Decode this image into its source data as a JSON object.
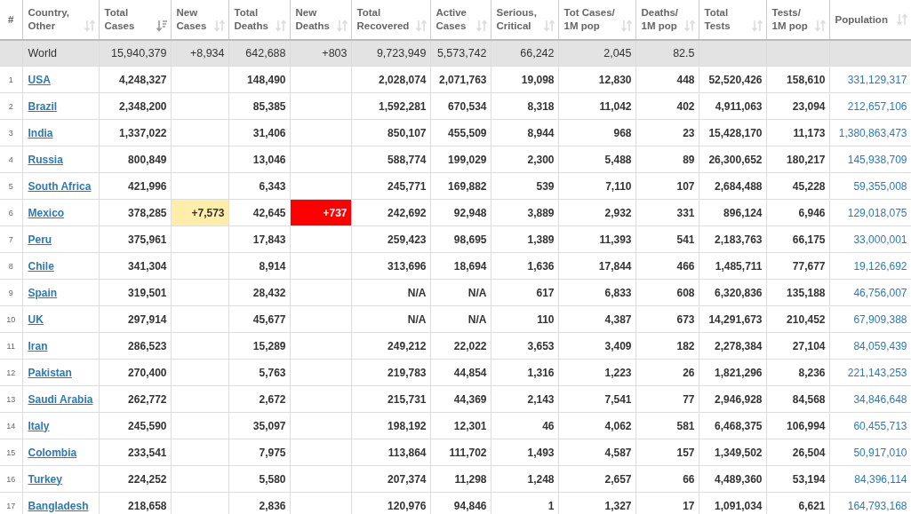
{
  "columns": [
    {
      "lines": [
        "#"
      ],
      "kind": "index"
    },
    {
      "lines": [
        "Country,",
        "Other"
      ],
      "kind": "sortable",
      "sorted": false
    },
    {
      "lines": [
        "Total",
        "Cases"
      ],
      "kind": "sortable",
      "sorted": true
    },
    {
      "lines": [
        "New",
        "Cases"
      ],
      "kind": "sortable",
      "sorted": false
    },
    {
      "lines": [
        "Total",
        "Deaths"
      ],
      "kind": "sortable",
      "sorted": false
    },
    {
      "lines": [
        "New",
        "Deaths"
      ],
      "kind": "sortable",
      "sorted": false
    },
    {
      "lines": [
        "Total",
        "Recovered"
      ],
      "kind": "sortable",
      "sorted": false
    },
    {
      "lines": [
        "Active",
        "Cases"
      ],
      "kind": "sortable",
      "sorted": false
    },
    {
      "lines": [
        "Serious,",
        "Critical"
      ],
      "kind": "sortable",
      "sorted": false
    },
    {
      "lines": [
        "Tot Cases/",
        "1M pop"
      ],
      "kind": "sortable",
      "sorted": false
    },
    {
      "lines": [
        "Deaths/",
        "1M pop"
      ],
      "kind": "sortable",
      "sorted": false
    },
    {
      "lines": [
        "Total",
        "Tests"
      ],
      "kind": "sortable",
      "sorted": false
    },
    {
      "lines": [
        "Tests/",
        "1M pop"
      ],
      "kind": "sortable",
      "sorted": false
    },
    {
      "lines": [
        "Population"
      ],
      "kind": "sortable",
      "sorted": false
    }
  ],
  "rows": [
    {
      "kind": "total",
      "country": "World",
      "total_cases": "15,940,379",
      "new_cases": "+8,934",
      "total_deaths": "642,688",
      "new_deaths": "+803",
      "total_recovered": "9,723,949",
      "active_cases": "5,573,742",
      "serious_critical": "66,242",
      "cases_per_1m": "2,045",
      "deaths_per_1m": "82.5"
    },
    {
      "kind": "country",
      "rank": "1",
      "country": "USA",
      "total_cases": "4,248,327",
      "total_deaths": "148,490",
      "total_recovered": "2,028,074",
      "active_cases": "2,071,763",
      "serious_critical": "19,098",
      "cases_per_1m": "12,830",
      "deaths_per_1m": "448",
      "total_tests": "52,520,426",
      "tests_per_1m": "158,610",
      "population": "331,129,317"
    },
    {
      "kind": "country",
      "rank": "2",
      "country": "Brazil",
      "total_cases": "2,348,200",
      "total_deaths": "85,385",
      "total_recovered": "1,592,281",
      "active_cases": "670,534",
      "serious_critical": "8,318",
      "cases_per_1m": "11,042",
      "deaths_per_1m": "402",
      "total_tests": "4,911,063",
      "tests_per_1m": "23,094",
      "population": "212,657,106"
    },
    {
      "kind": "country",
      "rank": "3",
      "country": "India",
      "total_cases": "1,337,022",
      "total_deaths": "31,406",
      "total_recovered": "850,107",
      "active_cases": "455,509",
      "serious_critical": "8,944",
      "cases_per_1m": "968",
      "deaths_per_1m": "23",
      "total_tests": "15,428,170",
      "tests_per_1m": "11,173",
      "population": "1,380,863,473"
    },
    {
      "kind": "country",
      "rank": "4",
      "country": "Russia",
      "total_cases": "800,849",
      "total_deaths": "13,046",
      "total_recovered": "588,774",
      "active_cases": "199,029",
      "serious_critical": "2,300",
      "cases_per_1m": "5,488",
      "deaths_per_1m": "89",
      "total_tests": "26,300,652",
      "tests_per_1m": "180,217",
      "population": "145,938,709"
    },
    {
      "kind": "country",
      "rank": "5",
      "country": "South Africa",
      "total_cases": "421,996",
      "total_deaths": "6,343",
      "total_recovered": "245,771",
      "active_cases": "169,882",
      "serious_critical": "539",
      "cases_per_1m": "7,110",
      "deaths_per_1m": "107",
      "total_tests": "2,684,488",
      "tests_per_1m": "45,228",
      "population": "59,355,008"
    },
    {
      "kind": "country",
      "rank": "6",
      "country": "Mexico",
      "total_cases": "378,285",
      "new_cases": "+7,573",
      "new_cases_highlight": {
        "color": "#ffeeaa"
      },
      "total_deaths": "42,645",
      "new_deaths": "+737",
      "new_deaths_highlight": {
        "color": "#ff0000"
      },
      "total_recovered": "242,692",
      "active_cases": "92,948",
      "serious_critical": "3,889",
      "cases_per_1m": "2,932",
      "deaths_per_1m": "331",
      "total_tests": "896,124",
      "tests_per_1m": "6,946",
      "population": "129,018,075"
    },
    {
      "kind": "country",
      "rank": "7",
      "country": "Peru",
      "total_cases": "375,961",
      "total_deaths": "17,843",
      "total_recovered": "259,423",
      "active_cases": "98,695",
      "serious_critical": "1,389",
      "cases_per_1m": "11,393",
      "deaths_per_1m": "541",
      "total_tests": "2,183,763",
      "tests_per_1m": "66,175",
      "population": "33,000,001"
    },
    {
      "kind": "country",
      "rank": "8",
      "country": "Chile",
      "total_cases": "341,304",
      "total_deaths": "8,914",
      "total_recovered": "313,696",
      "active_cases": "18,694",
      "serious_critical": "1,636",
      "cases_per_1m": "17,844",
      "deaths_per_1m": "466",
      "total_tests": "1,485,711",
      "tests_per_1m": "77,677",
      "population": "19,126,692"
    },
    {
      "kind": "country",
      "rank": "9",
      "country": "Spain",
      "total_cases": "319,501",
      "total_deaths": "28,432",
      "total_recovered": "N/A",
      "active_cases": "N/A",
      "serious_critical": "617",
      "cases_per_1m": "6,833",
      "deaths_per_1m": "608",
      "total_tests": "6,320,836",
      "tests_per_1m": "135,188",
      "population": "46,756,007"
    },
    {
      "kind": "country",
      "rank": "10",
      "country": "UK",
      "total_cases": "297,914",
      "total_deaths": "45,677",
      "total_recovered": "N/A",
      "active_cases": "N/A",
      "serious_critical": "110",
      "cases_per_1m": "4,387",
      "deaths_per_1m": "673",
      "total_tests": "14,291,673",
      "tests_per_1m": "210,452",
      "population": "67,909,388"
    },
    {
      "kind": "country",
      "rank": "11",
      "country": "Iran",
      "total_cases": "286,523",
      "total_deaths": "15,289",
      "total_recovered": "249,212",
      "active_cases": "22,022",
      "serious_critical": "3,653",
      "cases_per_1m": "3,409",
      "deaths_per_1m": "182",
      "total_tests": "2,278,384",
      "tests_per_1m": "27,104",
      "population": "84,059,439"
    },
    {
      "kind": "country",
      "rank": "12",
      "country": "Pakistan",
      "total_cases": "270,400",
      "total_deaths": "5,763",
      "total_recovered": "219,783",
      "active_cases": "44,854",
      "serious_critical": "1,316",
      "cases_per_1m": "1,223",
      "deaths_per_1m": "26",
      "total_tests": "1,821,296",
      "tests_per_1m": "8,236",
      "population": "221,143,253"
    },
    {
      "kind": "country",
      "rank": "13",
      "country": "Saudi Arabia",
      "total_cases": "262,772",
      "total_deaths": "2,672",
      "total_recovered": "215,731",
      "active_cases": "44,369",
      "serious_critical": "2,143",
      "cases_per_1m": "7,541",
      "deaths_per_1m": "77",
      "total_tests": "2,946,928",
      "tests_per_1m": "84,568",
      "population": "34,846,648"
    },
    {
      "kind": "country",
      "rank": "14",
      "country": "Italy",
      "total_cases": "245,590",
      "total_deaths": "35,097",
      "total_recovered": "198,192",
      "active_cases": "12,301",
      "serious_critical": "46",
      "cases_per_1m": "4,062",
      "deaths_per_1m": "581",
      "total_tests": "6,468,375",
      "tests_per_1m": "106,994",
      "population": "60,455,713"
    },
    {
      "kind": "country",
      "rank": "15",
      "country": "Colombia",
      "total_cases": "233,541",
      "total_deaths": "7,975",
      "total_recovered": "113,864",
      "active_cases": "111,702",
      "serious_critical": "1,493",
      "cases_per_1m": "4,587",
      "deaths_per_1m": "157",
      "total_tests": "1,349,502",
      "tests_per_1m": "26,504",
      "population": "50,917,010"
    },
    {
      "kind": "country",
      "rank": "16",
      "country": "Turkey",
      "total_cases": "224,252",
      "total_deaths": "5,580",
      "total_recovered": "207,374",
      "active_cases": "11,298",
      "serious_critical": "1,248",
      "cases_per_1m": "2,657",
      "deaths_per_1m": "66",
      "total_tests": "4,489,360",
      "tests_per_1m": "53,194",
      "population": "84,396,114"
    },
    {
      "kind": "country",
      "rank": "17",
      "country": "Bangladesh",
      "total_cases": "218,658",
      "total_deaths": "2,836",
      "total_recovered": "120,976",
      "active_cases": "94,846",
      "serious_critical": "1",
      "cases_per_1m": "1,327",
      "deaths_per_1m": "17",
      "total_tests": "1,091,034",
      "tests_per_1m": "6,621",
      "population": "164,793,168"
    }
  ]
}
